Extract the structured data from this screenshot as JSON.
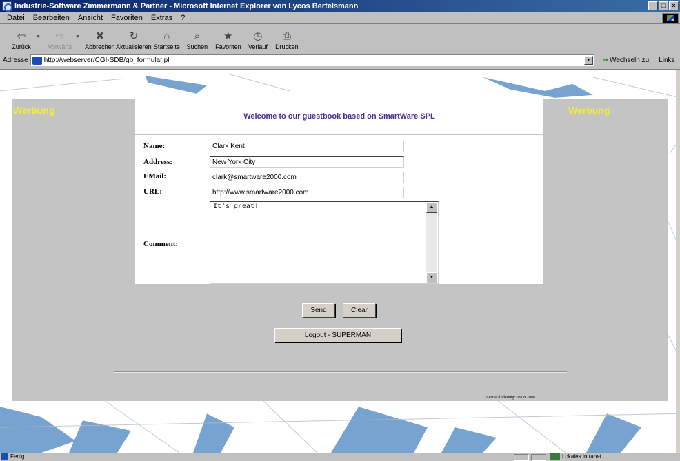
{
  "window": {
    "title": "Industrie-Software Zimmermann & Partner - Microsoft Internet Explorer von Lycos Bertelsmann",
    "buttons": [
      "_",
      "□",
      "×"
    ]
  },
  "menu": [
    "Datei",
    "Bearbeiten",
    "Ansicht",
    "Favoriten",
    "Extras",
    "?"
  ],
  "toolbar": [
    {
      "label": "Zurück",
      "icon": "back-arrow-icon",
      "glyph": "⇦",
      "enabled": true,
      "dropdown": true
    },
    {
      "label": "Vorwärts",
      "icon": "forward-arrow-icon",
      "glyph": "⇨",
      "enabled": false,
      "dropdown": true
    },
    {
      "label": "Abbrechen",
      "icon": "stop-icon",
      "glyph": "✖",
      "enabled": true,
      "dropdown": false
    },
    {
      "label": "Aktualisieren",
      "icon": "refresh-icon",
      "glyph": "↻",
      "enabled": true,
      "dropdown": false
    },
    {
      "label": "Startseite",
      "icon": "home-icon",
      "glyph": "⌂",
      "enabled": true,
      "dropdown": false
    },
    {
      "label": "Suchen",
      "icon": "search-icon",
      "glyph": "⌕",
      "enabled": true,
      "dropdown": false
    },
    {
      "label": "Favoriten",
      "icon": "favorites-folder-icon",
      "glyph": "★",
      "enabled": true,
      "dropdown": false
    },
    {
      "label": "Verlauf",
      "icon": "history-icon",
      "glyph": "◷",
      "enabled": true,
      "dropdown": false
    },
    {
      "label": "Drucken",
      "icon": "printer-icon",
      "glyph": "⎙",
      "enabled": true,
      "dropdown": false
    }
  ],
  "address": {
    "label": "Adresse",
    "url": "http://webserver/CGI-SDB/gb_formular.pl",
    "go_label": "Wechseln zu",
    "links_label": "Links"
  },
  "page": {
    "ad_left": "Werbung",
    "ad_right": "Werbung",
    "welcome": "Welcome to our guestbook based on SmartWare SPL",
    "form": {
      "name_label": "Name:",
      "name_value": "Clark Kent",
      "address_label": "Address:",
      "address_value": "New York City",
      "email_label": "EMail:",
      "email_value": "clark@smartware2000.com",
      "url_label": "URL:",
      "url_value": "http://www.smartware2000.com",
      "comment_label": "Comment:",
      "comment_value": "It's great!"
    },
    "send_label": "Send",
    "clear_label": "Clear",
    "logout_label": "Logout - SUPERMAN",
    "last_change": "Letzte Änderung: 08.08.2000"
  },
  "status": {
    "text": "Fertig",
    "zone": "Lokales Intranet"
  }
}
